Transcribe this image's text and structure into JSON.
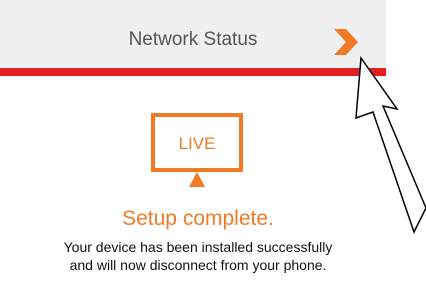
{
  "network_status": {
    "label": "Network Status",
    "chevron_icon": "chevron-right-icon",
    "accent_color": "#f07a26",
    "bar_color": "#e31e24"
  },
  "live_icon": {
    "text": "LIVE",
    "color": "#f07a26"
  },
  "setup": {
    "title": "Setup complete.",
    "description_line1": "Your device has been installed successfully",
    "description_line2": "and will now disconnect from your phone."
  },
  "annotation": {
    "icon": "outline-arrow-icon"
  }
}
